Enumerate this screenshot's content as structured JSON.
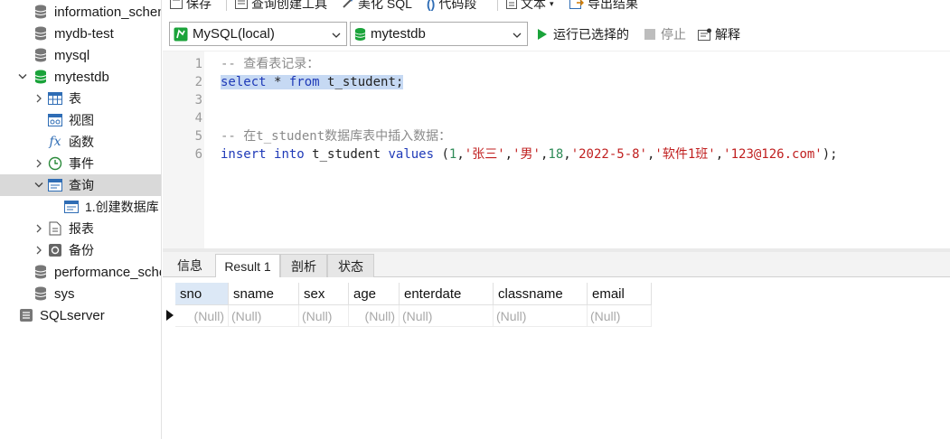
{
  "sidebar": {
    "items": [
      {
        "label": "information_schema",
        "icon": "database-icon"
      },
      {
        "label": "mydb-test",
        "icon": "database-icon"
      },
      {
        "label": "mysql",
        "icon": "database-icon"
      },
      {
        "label": "mytestdb",
        "icon": "database-open-icon",
        "expanded": true
      },
      {
        "label": "表",
        "icon": "table-icon"
      },
      {
        "label": "视图",
        "icon": "view-icon"
      },
      {
        "label": "函数",
        "icon": "function-icon"
      },
      {
        "label": "事件",
        "icon": "event-clock-icon"
      },
      {
        "label": "查询",
        "icon": "query-icon",
        "selected": true
      },
      {
        "label": "1.创建数据库",
        "icon": "query-file-icon"
      },
      {
        "label": "报表",
        "icon": "report-icon"
      },
      {
        "label": "备份",
        "icon": "backup-icon"
      },
      {
        "label": "performance_schema",
        "icon": "database-icon"
      },
      {
        "label": "sys",
        "icon": "database-icon"
      },
      {
        "label": "SQLserver",
        "icon": "sqlserver-connection-icon"
      }
    ]
  },
  "toolbar": {
    "save": "保存",
    "query_builder": "查询创建工具",
    "beautify_sql": "美化 SQL",
    "code_snippet": "代码段",
    "text": "文本",
    "export_result": "导出结果",
    "connection": "MySQL(local)",
    "database": "mytestdb",
    "run_selected": "运行已选择的",
    "stop": "停止",
    "explain": "解释"
  },
  "editor": {
    "line_numbers": [
      "1",
      "2",
      "3",
      "4",
      "5",
      "6"
    ],
    "line1": "-- 查看表记录：",
    "line2_kw1": "select",
    "line2_rest": " * ",
    "line2_kw2": "from",
    "line2_tbl": " t_student;",
    "line5": "-- 在t_student数据库表中插入数据：",
    "line6": {
      "kw1": "insert",
      "kw2": "into",
      "tbl": "t_student",
      "kw3": "values",
      "v1": "1",
      "v2": "'张三'",
      "v3": "'男'",
      "v4": "18",
      "v5": "'2022-5-8'",
      "v6": "'软件1班'",
      "v7": "'123@126.com'"
    }
  },
  "tabs": [
    "信息",
    "Result 1",
    "剖析",
    "状态"
  ],
  "result": {
    "columns": [
      "sno",
      "sname",
      "sex",
      "age",
      "enterdate",
      "classname",
      "email"
    ],
    "row": [
      "(Null)",
      "(Null)",
      "(Null)",
      "(Null)",
      "(Null)",
      "(Null)",
      "(Null)"
    ]
  },
  "colors": {
    "keyword": "#1f3ab8",
    "string": "#c01f1f",
    "number": "#2e8b57",
    "comment": "#8a8a8a",
    "db_green": "#1aa33a",
    "selection": "#c6d9f3"
  }
}
